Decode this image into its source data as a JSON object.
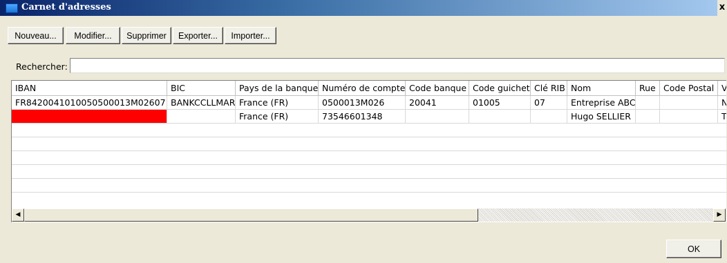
{
  "window": {
    "title": "Carnet d'adresses",
    "close_label": "x"
  },
  "toolbar": {
    "buttons": [
      {
        "label": "Nouveau..."
      },
      {
        "label": "Modifier..."
      },
      {
        "label": "Supprimer"
      },
      {
        "label": "Exporter..."
      },
      {
        "label": "Importer..."
      }
    ]
  },
  "search": {
    "label": "Rechercher:",
    "value": ""
  },
  "table": {
    "columns": [
      {
        "label": "IBAN"
      },
      {
        "label": "BIC"
      },
      {
        "label": "Pays de la banque"
      },
      {
        "label": "Numéro de compte"
      },
      {
        "label": "Code banque"
      },
      {
        "label": "Code guichet"
      },
      {
        "label": "Clé RIB"
      },
      {
        "label": "Nom"
      },
      {
        "label": "Rue"
      },
      {
        "label": "Code Postal"
      },
      {
        "label": "Vi"
      }
    ],
    "rows": [
      [
        "FR8420041010050500013M02607",
        "BANKCCLLMAR",
        "France (FR)",
        "0500013M026",
        "20041",
        "01005",
        "07",
        "Entreprise ABC",
        "",
        "",
        "N/"
      ],
      [
        "",
        "",
        "France (FR)",
        "73546601348",
        "",
        "",
        "",
        "Hugo SELLIER",
        "",
        "",
        "TC"
      ]
    ],
    "highlight_color": "#ff0000"
  },
  "scrollbar": {
    "left_arrow": "◀",
    "right_arrow": "▶"
  },
  "footer": {
    "ok_label": "OK"
  }
}
